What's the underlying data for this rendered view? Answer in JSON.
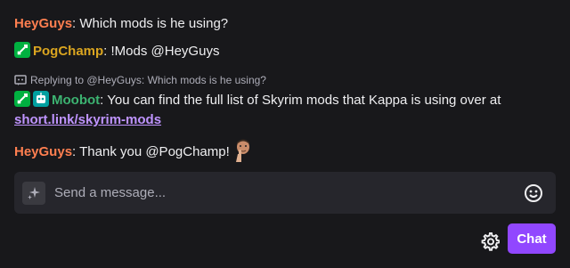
{
  "colors": {
    "heyguys": "#ff7f50",
    "pogchamp": "#daa520",
    "moobot": "#3cb371",
    "link": "#bf94ff",
    "accent": "#9147ff"
  },
  "messages": [
    {
      "user": "HeyGuys",
      "sep": ": ",
      "text": "Which mods is he using?"
    },
    {
      "user": "PogChamp",
      "sep": ": ",
      "text": "!Mods @HeyGuys",
      "badge": "sword-icon"
    },
    {
      "reply": "Replying to @HeyGuys: Which mods is he using?",
      "user": "Moobot",
      "sep": ": ",
      "text": "You can find the full list of Skyrim mods that Kappa is using over at",
      "link": "short.link/skyrim-mods",
      "badges": [
        "sword-icon",
        "robot-icon"
      ]
    },
    {
      "user": "HeyGuys",
      "sep": ": ",
      "text": "Thank you @PogChamp!",
      "emote": "thumbs-up-emote"
    }
  ],
  "input": {
    "placeholder": "Send a message..."
  },
  "chat_button": "Chat"
}
